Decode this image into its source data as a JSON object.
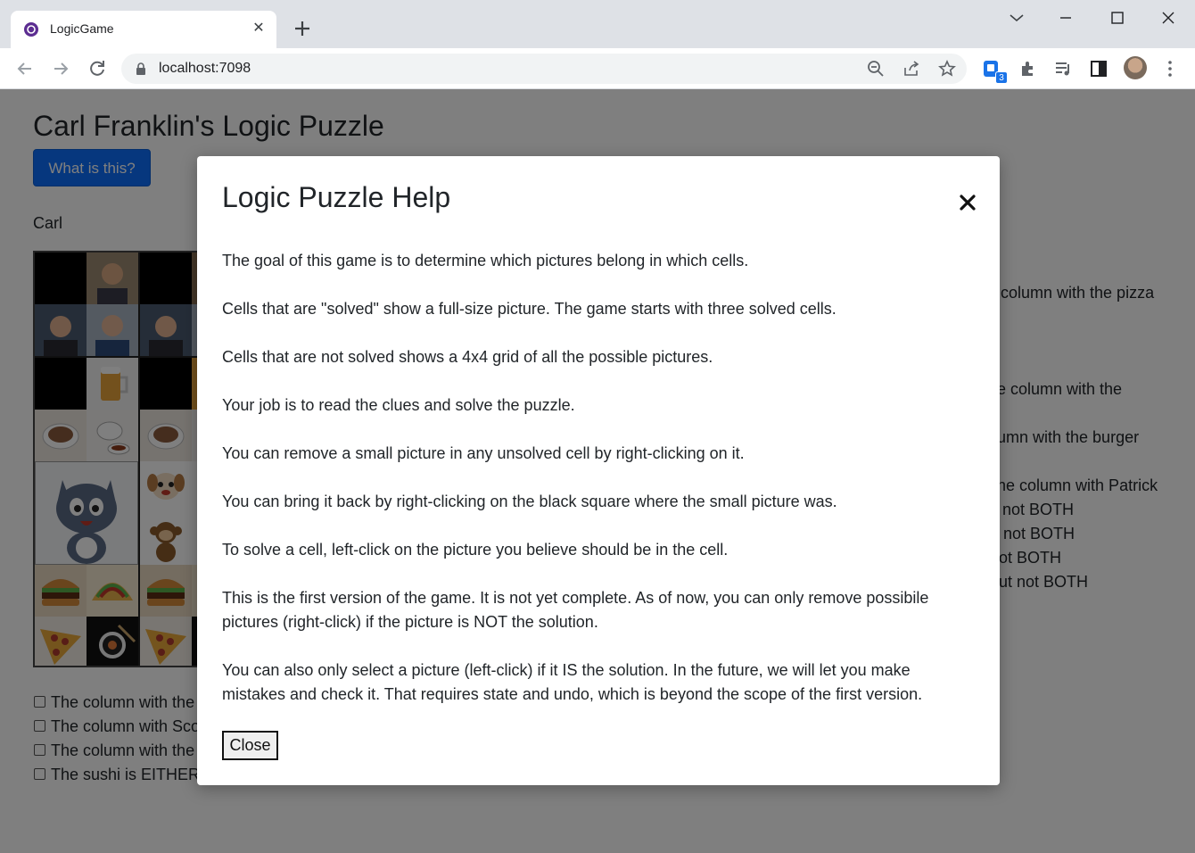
{
  "browser": {
    "tab_title": "LogicGame",
    "tab_close": "✕",
    "url": "localhost:7098",
    "extension_badge": "3"
  },
  "page": {
    "title": "Carl Franklin's Logic Puzzle",
    "what_button": "What is this?",
    "player_name": "Carl",
    "clues_right": [
      "column with the pizza",
      "e column with the",
      "umn with the burger",
      "he column with Patrick",
      "not BOTH",
      "not BOTH",
      "ot BOTH",
      "ut not BOTH"
    ],
    "clues_left": [
      "The column with the",
      "The column with Sco",
      "The column with the",
      "The sushi is EITHER"
    ]
  },
  "modal": {
    "title": "Logic Puzzle Help",
    "close_x": "×",
    "paragraphs": [
      "The goal of this game is to determine which pictures belong in which cells.",
      "Cells that are \"solved\" show a full-size picture. The game starts with three solved cells.",
      "Cells that are not solved shows a 4x4 grid of all the possible pictures.",
      "Your job is to read the clues and solve the puzzle.",
      "You can remove a small picture in any unsolved cell by right-clicking on it.",
      "You can bring it back by right-clicking on the black square where the small picture was.",
      "To solve a cell, left-click on the picture you believe should be in the cell.",
      "This is the first version of the game. It is not yet complete. As of now, you can only remove possibile pictures (right-click) if the picture is NOT the solution.",
      "You can also only select a picture (left-click) if it IS the solution. In the future, we will let you make mistakes and check it. That requires state and undo, which is beyond the scope of the first version."
    ],
    "close_button": "Close"
  },
  "colors": {
    "primary": "#0d6efd",
    "overlay": "rgba(0,0,0,0.5)"
  }
}
